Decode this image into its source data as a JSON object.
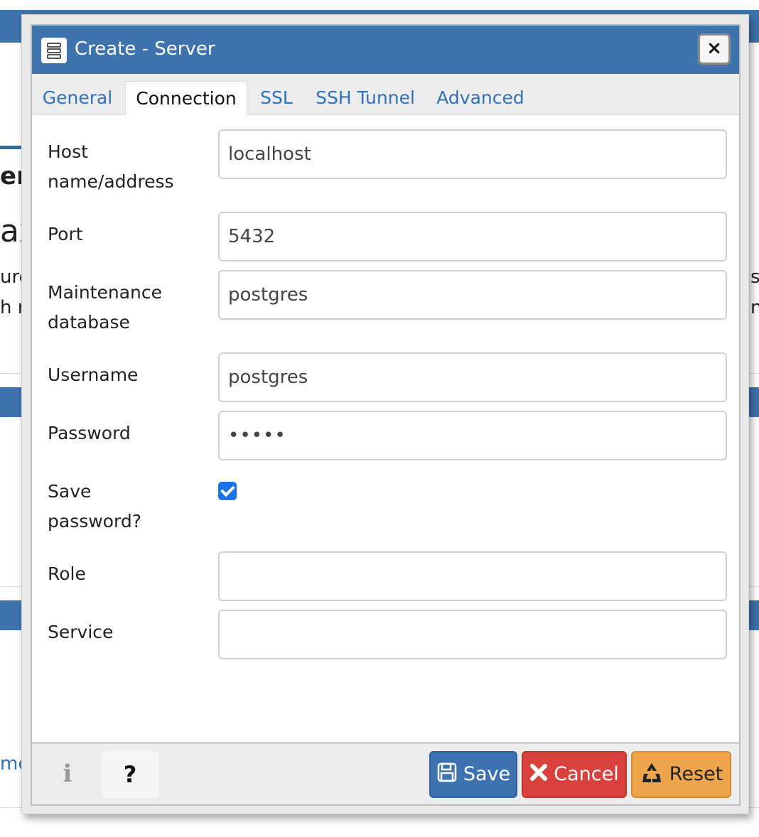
{
  "dialog": {
    "title": "Create - Server",
    "close_label": "×"
  },
  "tabs": [
    {
      "label": "General"
    },
    {
      "label": "Connection",
      "active": true
    },
    {
      "label": "SSL"
    },
    {
      "label": "SSH Tunnel"
    },
    {
      "label": "Advanced"
    }
  ],
  "form": {
    "host": {
      "label_line1": "Host",
      "label_line2": "name/address",
      "value": "localhost"
    },
    "port": {
      "label": "Port",
      "value": "5432"
    },
    "maintenance_db": {
      "label_line1": "Maintenance",
      "label_line2": "database",
      "value": "postgres"
    },
    "username": {
      "label": "Username",
      "value": "postgres"
    },
    "password": {
      "label": "Password",
      "value": "•••••"
    },
    "save_password": {
      "label_line1": "Save",
      "label_line2": "password?",
      "checked": true
    },
    "role": {
      "label": "Role",
      "value": ""
    },
    "service": {
      "label": "Service",
      "value": ""
    }
  },
  "footer": {
    "info_label": "i",
    "help_label": "?",
    "save_label": "Save",
    "cancel_label": "Cancel",
    "reset_label": "Reset"
  },
  "background": {
    "fragments": [
      "ax",
      "urc",
      "h r",
      "er",
      "me",
      "s",
      "n"
    ]
  },
  "colors": {
    "titlebar": "#3f73ae",
    "save": "#3c73b0",
    "cancel": "#d9423c",
    "reset": "#eda44b",
    "checkbox": "#1a73e8",
    "tab_link": "#3471b2"
  }
}
